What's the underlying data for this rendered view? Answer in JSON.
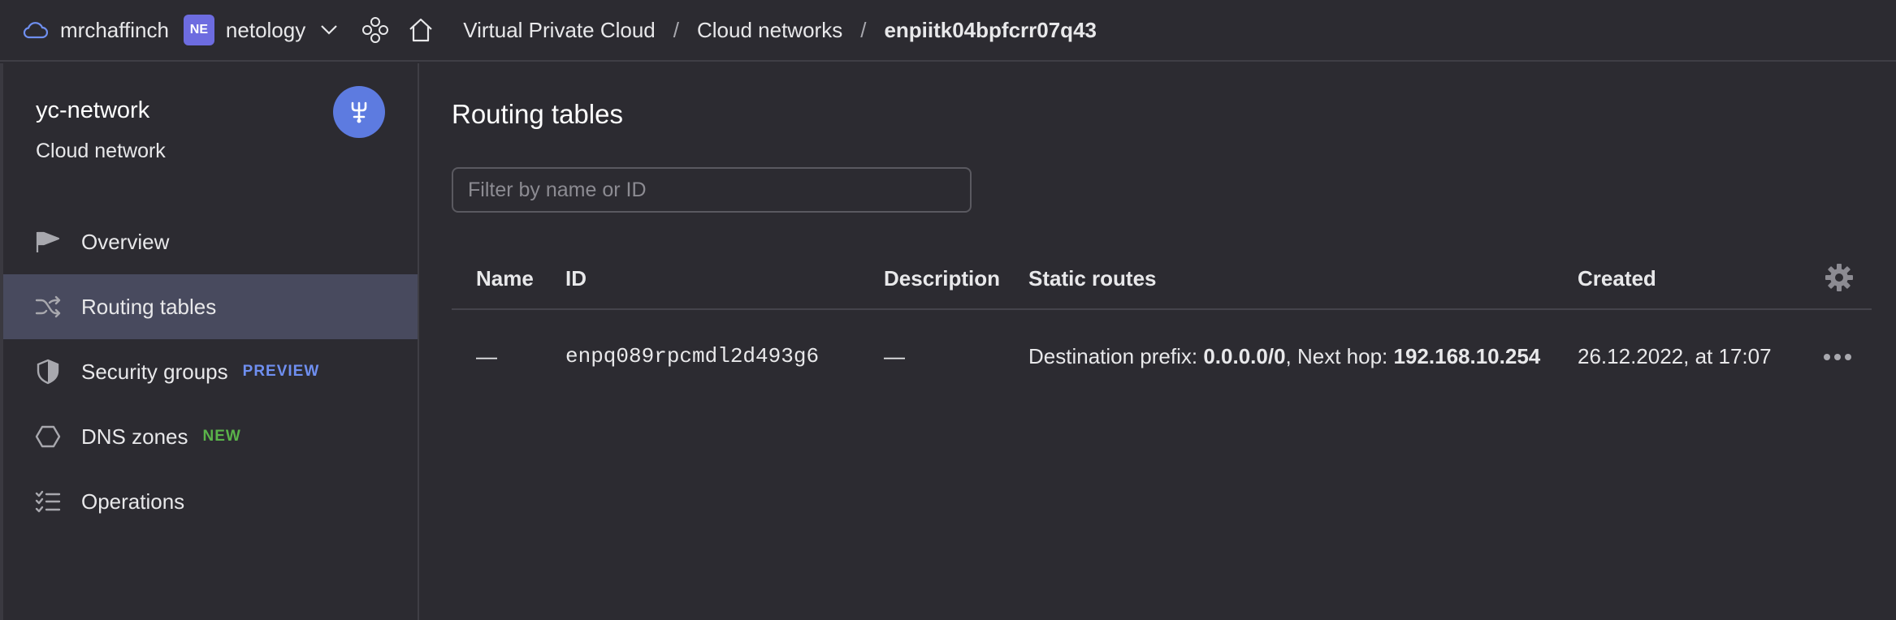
{
  "topbar": {
    "cloud_name": "mrchaffinch",
    "org_badge": "NE",
    "org_name": "netology",
    "breadcrumbs": [
      {
        "label": "Virtual Private Cloud"
      },
      {
        "label": "Cloud networks"
      },
      {
        "label": "enpiitk04bpfcrr07q43"
      }
    ],
    "separator": "/"
  },
  "sidebar": {
    "title": "yc-network",
    "subtitle": "Cloud network",
    "items": [
      {
        "label": "Overview",
        "icon": "flag-icon",
        "active": false
      },
      {
        "label": "Routing tables",
        "icon": "shuffle-icon",
        "active": true
      },
      {
        "label": "Security groups",
        "icon": "shield-icon",
        "badge": "PREVIEW",
        "active": false
      },
      {
        "label": "DNS zones",
        "icon": "hexagon-icon",
        "badge": "NEW",
        "active": false
      },
      {
        "label": "Operations",
        "icon": "checklist-icon",
        "active": false
      }
    ]
  },
  "main": {
    "title": "Routing tables",
    "filter_placeholder": "Filter by name or ID",
    "table": {
      "columns": [
        "Name",
        "ID",
        "Description",
        "Static routes",
        "Created"
      ],
      "rows": [
        {
          "name": "—",
          "id": "enpq089rpcmdl2d493g6",
          "description": "—",
          "route_prefix_label": "Destination prefix:",
          "route_prefix": "0.0.0.0/0",
          "route_hop_label": ", Next hop:",
          "route_hop": "192.168.10.254",
          "created": "26.12.2022, at 17:07"
        }
      ]
    }
  },
  "colors": {
    "background": "#2c2b31",
    "active_nav": "#484a5e",
    "org_badge": "#6d6ce0",
    "network_avatar": "#5d7be0",
    "badge_preview": "#6f8ff0",
    "badge_new": "#5ab34a"
  }
}
